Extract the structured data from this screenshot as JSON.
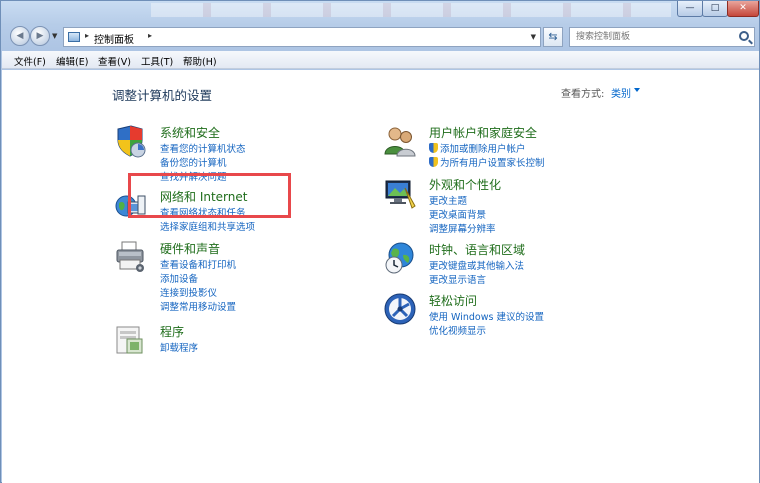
{
  "window": {
    "controls": {
      "minimize": "—",
      "maximize": "□",
      "close": "✕"
    }
  },
  "address": {
    "crumb": "控制面板",
    "search_placeholder": "搜索控制面板"
  },
  "menu": [
    "文件(F)",
    "编辑(E)",
    "查看(V)",
    "工具(T)",
    "帮助(H)"
  ],
  "page": {
    "title": "调整计算机的设置",
    "view_by_label": "查看方式:",
    "view_by_value": "类别"
  },
  "categories_left": [
    {
      "title": "系统和安全",
      "icon": "shield-icon",
      "links": [
        "查看您的计算机状态",
        "备份您的计算机",
        "查找并解决问题"
      ]
    },
    {
      "title": "网络和 Internet",
      "icon": "network-globe-icon",
      "links": [
        "查看网络状态和任务",
        "选择家庭组和共享选项"
      ]
    },
    {
      "title": "硬件和声音",
      "icon": "printer-icon",
      "links": [
        "查看设备和打印机",
        "添加设备",
        "连接到投影仪",
        "调整常用移动设置"
      ]
    },
    {
      "title": "程序",
      "icon": "programs-icon",
      "links": [
        "卸载程序"
      ]
    }
  ],
  "categories_right": [
    {
      "title": "用户帐户和家庭安全",
      "icon": "users-icon",
      "links": [
        "添加或删除用户帐户",
        "为所有用户设置家长控制"
      ]
    },
    {
      "title": "外观和个性化",
      "icon": "display-icon",
      "links": [
        "更改主题",
        "更改桌面背景",
        "调整屏幕分辨率"
      ]
    },
    {
      "title": "时钟、语言和区域",
      "icon": "clock-globe-icon",
      "links": [
        "更改键盘或其他输入法",
        "更改显示语言"
      ]
    },
    {
      "title": "轻松访问",
      "icon": "accessibility-icon",
      "links": [
        "使用 Windows 建议的设置",
        "优化视频显示"
      ]
    }
  ],
  "colors": {
    "category_title": "#1f6d1b",
    "link": "#1565c0",
    "highlight_box": "#e8484b"
  }
}
